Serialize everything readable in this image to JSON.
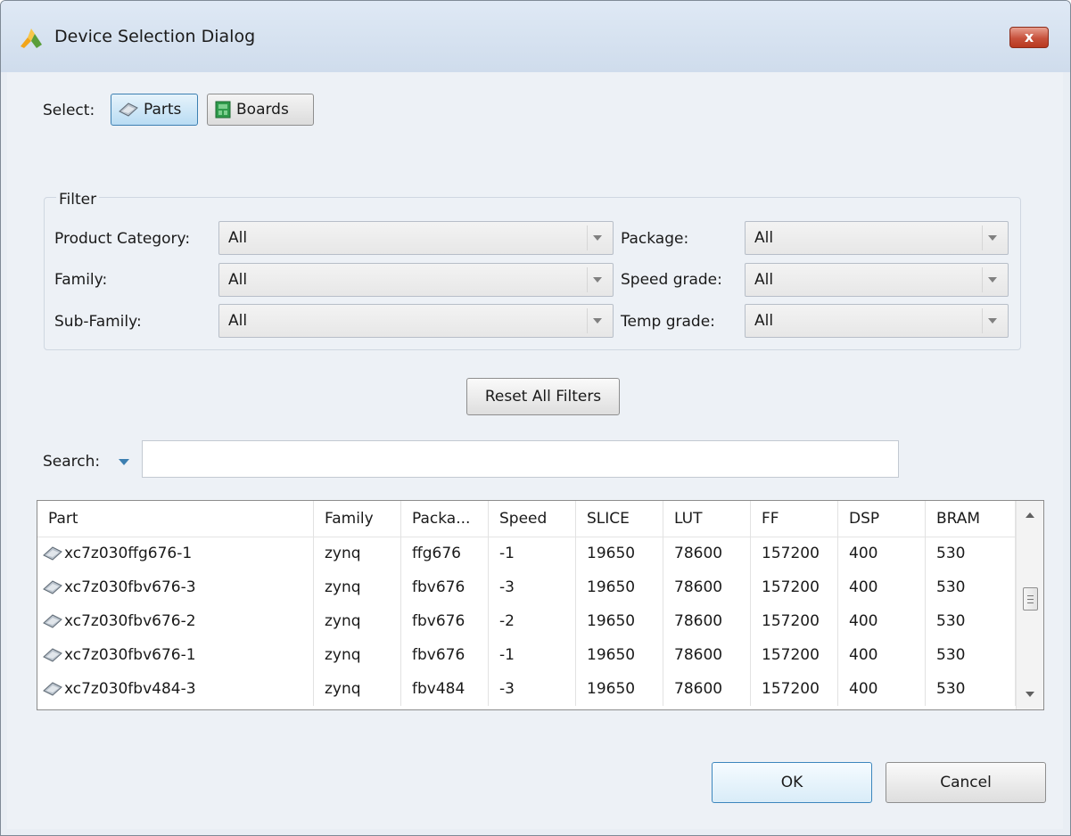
{
  "window": {
    "title": "Device Selection Dialog",
    "close_glyph": "x"
  },
  "select": {
    "label": "Select:",
    "parts_label": "Parts",
    "boards_label": "Boards",
    "active": "Parts"
  },
  "filter": {
    "legend": "Filter",
    "product_category": {
      "label": "Product Category:",
      "value": "All"
    },
    "family": {
      "label": "Family:",
      "value": "All"
    },
    "sub_family": {
      "label": "Sub-Family:",
      "value": "All"
    },
    "package": {
      "label": "Package:",
      "value": "All"
    },
    "speed_grade": {
      "label": "Speed grade:",
      "value": "All"
    },
    "temp_grade": {
      "label": "Temp grade:",
      "value": "All"
    }
  },
  "reset_label": "Reset All Filters",
  "search": {
    "label": "Search:",
    "value": ""
  },
  "table": {
    "columns": [
      "Part",
      "Family",
      "Packa...",
      "Speed",
      "SLICE",
      "LUT",
      "FF",
      "DSP",
      "BRAM"
    ],
    "rows": [
      [
        "xc7z030ffg676-1",
        "zynq",
        "ffg676",
        "-1",
        "19650",
        "78600",
        "157200",
        "400",
        "530"
      ],
      [
        "xc7z030fbv676-3",
        "zynq",
        "fbv676",
        "-3",
        "19650",
        "78600",
        "157200",
        "400",
        "530"
      ],
      [
        "xc7z030fbv676-2",
        "zynq",
        "fbv676",
        "-2",
        "19650",
        "78600",
        "157200",
        "400",
        "530"
      ],
      [
        "xc7z030fbv676-1",
        "zynq",
        "fbv676",
        "-1",
        "19650",
        "78600",
        "157200",
        "400",
        "530"
      ],
      [
        "xc7z030fbv484-3",
        "zynq",
        "fbv484",
        "-3",
        "19650",
        "78600",
        "157200",
        "400",
        "530"
      ]
    ]
  },
  "buttons": {
    "ok": "OK",
    "cancel": "Cancel"
  },
  "icons": {
    "app": "xilinx-logo-icon",
    "parts": "chip-icon",
    "boards": "board-icon",
    "row": "chip-icon"
  },
  "colors": {
    "accent": "#3c7fb1",
    "close": "#c7513c",
    "board": "#2e9a4b"
  }
}
